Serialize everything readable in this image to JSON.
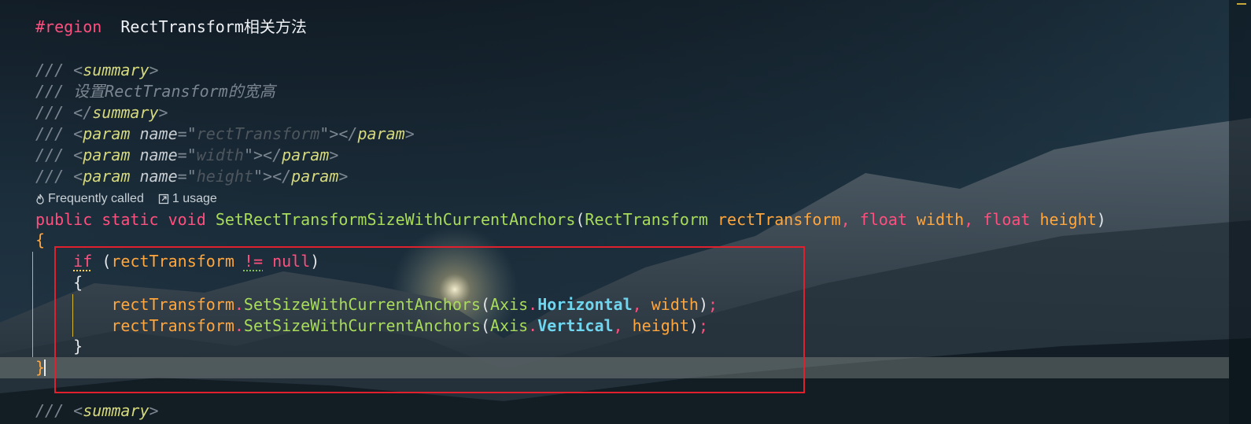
{
  "editor": {
    "region_line": {
      "directive": "#region",
      "name": "RectTransform相关方法"
    },
    "doc_comment": {
      "summary_open": "<summary>",
      "summary_text": "设置RectTransform的宽高",
      "summary_close": "</summary>",
      "params": [
        {
          "name": "rectTransform"
        },
        {
          "name": "width"
        },
        {
          "name": "height"
        }
      ]
    },
    "code_vision": {
      "frequently_called": "Frequently called",
      "usage": "1 usage"
    },
    "method": {
      "modifiers": [
        "public",
        "static",
        "void"
      ],
      "name": "SetRectTransformSizeWithCurrentAnchors",
      "param1_type": "RectTransform",
      "param1_name": "rectTransform",
      "param2_type": "float",
      "param2_name": "width",
      "param3_type": "float",
      "param3_name": "height"
    },
    "body": {
      "if_keyword": "if",
      "if_subject": "rectTransform",
      "if_operator": "!=",
      "if_null": "null",
      "call_target": "rectTransform",
      "call_method": "SetSizeWithCurrentAnchors",
      "enum_type": "Axis",
      "enum_horizontal": "Horizontal",
      "enum_vertical": "Vertical",
      "arg_width": "width",
      "arg_height": "height"
    },
    "next_summary": "<summary>"
  },
  "colors": {
    "keyword": "#ff4f7e",
    "function": "#a8dc5a",
    "variable": "#ffa63d",
    "enum_member": "#6fd6f0",
    "comment": "#7b8691",
    "doc_tag": "#d6d97c",
    "highlight_box": "#e0202c",
    "current_line": "#8e948e"
  }
}
